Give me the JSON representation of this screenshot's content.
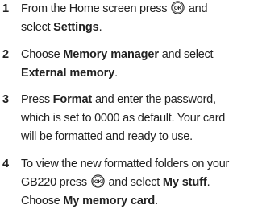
{
  "steps": [
    {
      "number": "1",
      "t1": "From the Home screen press",
      "ok_icon": "ok-key-icon",
      "t2": "and",
      "t3": "select",
      "b1": "Settings",
      "t4": "."
    },
    {
      "number": "2",
      "t1": "Choose",
      "b1": "Memory manager",
      "t2": "and select",
      "b2": "External memory",
      "t3": "."
    },
    {
      "number": "3",
      "t1": "Press",
      "b1": "Format",
      "t2": "and enter the password,",
      "l2": "which is set to 0000 as default. Your card",
      "l3": "will be formatted and ready to use."
    },
    {
      "number": "4",
      "l1": "To view the new formatted folders on your",
      "t1": "GB220 press",
      "ok_icon": "ok-key-icon",
      "t2": "and select",
      "b1": "My stuff",
      "t3": ".",
      "t4": "Choose",
      "b2": "My memory card",
      "t5": "."
    }
  ]
}
